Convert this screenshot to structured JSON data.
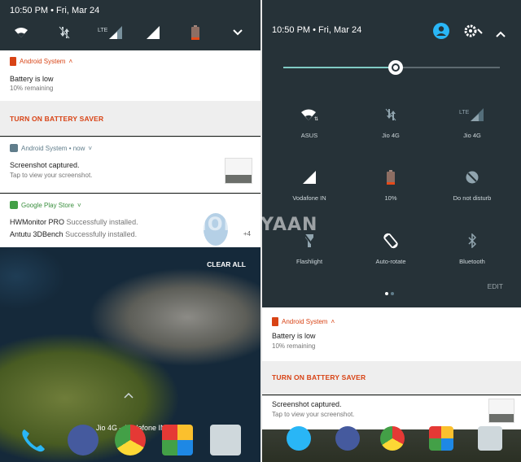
{
  "left": {
    "status": {
      "time": "10:50 PM  •  Fri, Mar 24"
    },
    "battery_notification": {
      "app": "Android System",
      "title": "Battery is low",
      "subtitle": "10% remaining",
      "action": "TURN ON BATTERY SAVER"
    },
    "screenshot_notification": {
      "app": "Android System • now",
      "title": "Screenshot captured.",
      "subtitle": "Tap to view your screenshot."
    },
    "play_notification": {
      "app": "Google Play Store",
      "items": [
        {
          "name": "HWMonitor PRO",
          "status": "Successfully installed."
        },
        {
          "name": "Antutu 3DBench",
          "status": "Successfully installed."
        }
      ],
      "more": "+4"
    },
    "clear_all": "CLEAR ALL",
    "carrier": "Jio 4G – Vodafone IN"
  },
  "right": {
    "status": {
      "time": "10:50 PM  •  Fri, Mar 24"
    },
    "brightness_level": 0.52,
    "tiles": [
      {
        "label": "ASUS",
        "icon": "wifi-icon"
      },
      {
        "label": "Jio 4G",
        "icon": "no-data-icon"
      },
      {
        "label": "Jio 4G",
        "icon": "lte-signal-icon"
      },
      {
        "label": "Vodafone IN",
        "icon": "signal-icon"
      },
      {
        "label": "10%",
        "icon": "battery-icon"
      },
      {
        "label": "Do not disturb",
        "icon": "do-not-disturb-icon"
      },
      {
        "label": "Flashlight",
        "icon": "flashlight-icon"
      },
      {
        "label": "Auto-rotate",
        "icon": "auto-rotate-icon"
      },
      {
        "label": "Bluetooth",
        "icon": "bluetooth-icon"
      }
    ],
    "edit": "EDIT",
    "battery_notification": {
      "app": "Android System",
      "title": "Battery is low",
      "subtitle": "10% remaining",
      "action": "TURN ON BATTERY SAVER"
    },
    "screenshot_notification": {
      "title": "Screenshot captured.",
      "subtitle": "Tap to view your screenshot."
    }
  },
  "watermark": "MOBIGYAAN",
  "colors": {
    "statusbar": "#263238",
    "accent_orange": "#d84315",
    "teal": "#80cbc4",
    "account_blue": "#29b6f6",
    "play_green": "#43a047"
  }
}
